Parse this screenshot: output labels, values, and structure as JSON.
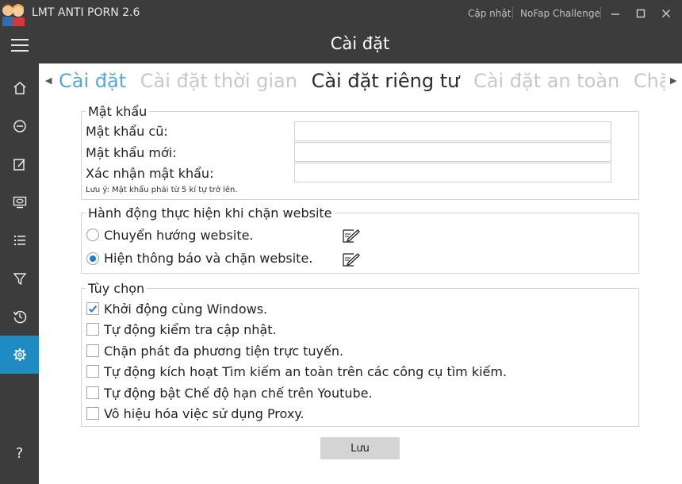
{
  "window": {
    "title": "LMT ANTI PORN 2.6",
    "links": [
      "Cập nhật",
      "NoFap Challenge"
    ],
    "controls": [
      "minimize-icon",
      "maximize-icon",
      "close-icon"
    ]
  },
  "header": {
    "title": "Cài đặt",
    "menu_icon": "hamburger-icon"
  },
  "sidebar": {
    "items": [
      {
        "icon": "home-icon"
      },
      {
        "icon": "block-icon"
      },
      {
        "icon": "edit-icon"
      },
      {
        "icon": "monitor-eye-icon"
      },
      {
        "icon": "list-icon"
      },
      {
        "icon": "filter-icon"
      },
      {
        "icon": "history-icon"
      },
      {
        "icon": "gear-icon",
        "active": true
      }
    ],
    "help": "?"
  },
  "tabs": {
    "items": [
      "Cài đặt",
      "Cài đặt thời gian",
      "Cài đặt riêng tư",
      "Cài đặt an toàn",
      "Chặn c"
    ],
    "selected": "Cài đặt riêng tư"
  },
  "password": {
    "group_title": "Mật khẩu",
    "old_label": "Mật khẩu cũ:",
    "new_label": "Mật khẩu mới:",
    "confirm_label": "Xác nhận mật khẩu:",
    "old_value": "",
    "new_value": "",
    "confirm_value": "",
    "note": "Lưu ý: Mật khẩu phải từ 5 kí tự trở lên."
  },
  "block_action": {
    "group_title": "Hành động thực hiện khi chặn website",
    "options": [
      {
        "label": "Chuyển hướng website.",
        "selected": false
      },
      {
        "label": "Hiện thông báo và chặn website.",
        "selected": true
      }
    ]
  },
  "options": {
    "group_title": "Tùy chọn",
    "items": [
      {
        "label": "Khởi động cùng Windows.",
        "checked": true
      },
      {
        "label": "Tự động kiểm tra cập nhật.",
        "checked": false
      },
      {
        "label": "Chặn phát đa phương tiện trực tuyến.",
        "checked": false
      },
      {
        "label": "Tự động kích hoạt Tìm kiếm an toàn trên các công cụ tìm kiếm.",
        "checked": false
      },
      {
        "label": "Tự động bật Chế độ hạn chế trên Youtube.",
        "checked": false
      },
      {
        "label": "Vô hiệu hóa việc sử dụng Proxy.",
        "checked": false
      }
    ]
  },
  "save_label": "Lưu",
  "colors": {
    "chrome": "#3c3c3c",
    "accent": "#1e8bc3",
    "tab_first": "#5aa7d6"
  }
}
